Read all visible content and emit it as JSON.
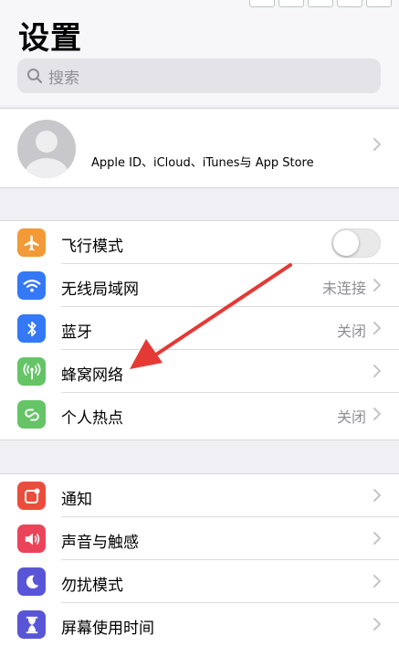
{
  "header": {
    "title": "设置"
  },
  "search": {
    "placeholder": "搜索"
  },
  "profile": {
    "label": "Apple ID、iCloud、iTunes与 App Store"
  },
  "network_group": [
    {
      "label": "飞行模式",
      "icon": "airplane-icon",
      "color": "#f19a37",
      "toggle": false
    },
    {
      "label": "无线局域网",
      "icon": "wifi-icon",
      "color": "#3478f6",
      "value": "未连接"
    },
    {
      "label": "蓝牙",
      "icon": "bluetooth-icon",
      "color": "#3478f6",
      "value": "关闭"
    },
    {
      "label": "蜂窝网络",
      "icon": "cellular-icon",
      "color": "#65c466"
    },
    {
      "label": "个人热点",
      "icon": "hotspot-icon",
      "color": "#65c466",
      "value": "关闭"
    }
  ],
  "general_group": [
    {
      "label": "通知",
      "icon": "notifications-icon",
      "color": "#eb4d3d"
    },
    {
      "label": "声音与触感",
      "icon": "sound-icon",
      "color": "#eb445a"
    },
    {
      "label": "勿扰模式",
      "icon": "moon-icon",
      "color": "#5856d6"
    },
    {
      "label": "屏幕使用时间",
      "icon": "hourglass-icon",
      "color": "#5856d6"
    }
  ],
  "annotation": {
    "color": "#e53935"
  }
}
